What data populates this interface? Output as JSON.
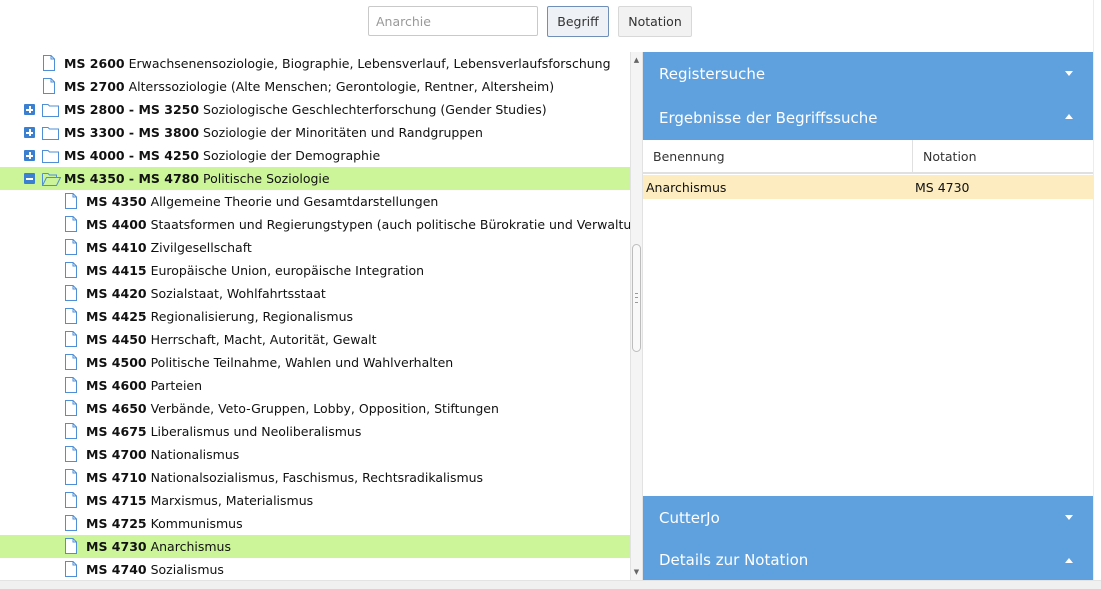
{
  "search": {
    "placeholder": "Anarchie",
    "begriff_label": "Begriff",
    "notation_label": "Notation"
  },
  "tree": {
    "rows": [
      {
        "code": "MS 2600",
        "label": "Erwachsenensoziologie, Biographie, Lebensverlauf, Lebensverlaufsforschung",
        "type": "leaf",
        "level": 1,
        "selected": false
      },
      {
        "code": "MS 2700",
        "label": "Alterssoziologie (Alte Menschen; Gerontologie, Rentner, Altersheim)",
        "type": "leaf",
        "level": 1,
        "selected": false
      },
      {
        "code": "MS 2800 - MS 3250",
        "label": "Soziologische Geschlechterforschung (Gender Studies)",
        "type": "folder",
        "expanded": false,
        "level": 1,
        "selected": false
      },
      {
        "code": "MS 3300 - MS 3800",
        "label": "Soziologie der Minoritäten und Randgruppen",
        "type": "folder",
        "expanded": false,
        "level": 1,
        "selected": false
      },
      {
        "code": "MS 4000 - MS 4250",
        "label": "Soziologie der Demographie",
        "type": "folder",
        "expanded": false,
        "level": 1,
        "selected": false
      },
      {
        "code": "MS 4350 - MS 4780",
        "label": "Politische Soziologie",
        "type": "folder",
        "expanded": true,
        "level": 1,
        "selected": true
      },
      {
        "code": "MS 4350",
        "label": "Allgemeine Theorie und Gesamtdarstellungen",
        "type": "leaf",
        "level": 2,
        "selected": false
      },
      {
        "code": "MS 4400",
        "label": "Staatsformen und Regierungstypen (auch politische Bürokratie und Verwaltung)",
        "type": "leaf",
        "level": 2,
        "selected": false
      },
      {
        "code": "MS 4410",
        "label": "Zivilgesellschaft",
        "type": "leaf",
        "level": 2,
        "selected": false
      },
      {
        "code": "MS 4415",
        "label": "Europäische Union, europäische Integration",
        "type": "leaf",
        "level": 2,
        "selected": false
      },
      {
        "code": "MS 4420",
        "label": "Sozialstaat, Wohlfahrtsstaat",
        "type": "leaf",
        "level": 2,
        "selected": false
      },
      {
        "code": "MS 4425",
        "label": "Regionalisierung, Regionalismus",
        "type": "leaf",
        "level": 2,
        "selected": false
      },
      {
        "code": "MS 4450",
        "label": "Herrschaft, Macht, Autorität, Gewalt",
        "type": "leaf",
        "level": 2,
        "selected": false
      },
      {
        "code": "MS 4500",
        "label": "Politische Teilnahme, Wahlen und Wahlverhalten",
        "type": "leaf",
        "level": 2,
        "selected": false
      },
      {
        "code": "MS 4600",
        "label": "Parteien",
        "type": "leaf",
        "level": 2,
        "selected": false
      },
      {
        "code": "MS 4650",
        "label": "Verbände, Veto-Gruppen, Lobby, Opposition, Stiftungen",
        "type": "leaf",
        "level": 2,
        "selected": false
      },
      {
        "code": "MS 4675",
        "label": "Liberalismus und Neoliberalismus",
        "type": "leaf",
        "level": 2,
        "selected": false
      },
      {
        "code": "MS 4700",
        "label": "Nationalismus",
        "type": "leaf",
        "level": 2,
        "selected": false
      },
      {
        "code": "MS 4710",
        "label": "Nationalsozialismus, Faschismus, Rechtsradikalismus",
        "type": "leaf",
        "level": 2,
        "selected": false
      },
      {
        "code": "MS 4715",
        "label": "Marxismus, Materialismus",
        "type": "leaf",
        "level": 2,
        "selected": false
      },
      {
        "code": "MS 4725",
        "label": "Kommunismus",
        "type": "leaf",
        "level": 2,
        "selected": false
      },
      {
        "code": "MS 4730",
        "label": "Anarchismus",
        "type": "leaf",
        "level": 2,
        "selected": true
      },
      {
        "code": "MS 4740",
        "label": "Sozialismus",
        "type": "leaf",
        "level": 2,
        "selected": false
      }
    ]
  },
  "accordion": {
    "registersuche": "Registersuche",
    "ergebnisse": "Ergebnisse der Begriffssuche",
    "cutterjo": "CutterJo",
    "details": "Details zur Notation"
  },
  "results": {
    "col_benennung": "Benennung",
    "col_notation": "Notation",
    "rows": [
      {
        "benennung": "Anarchismus",
        "notation": "MS 4730"
      }
    ]
  },
  "colors": {
    "accordion_header": "#5fa1df",
    "selection_green": "#ccf59a",
    "result_highlight": "#fcecbf",
    "toggle_blue": "#3b7fd0"
  }
}
